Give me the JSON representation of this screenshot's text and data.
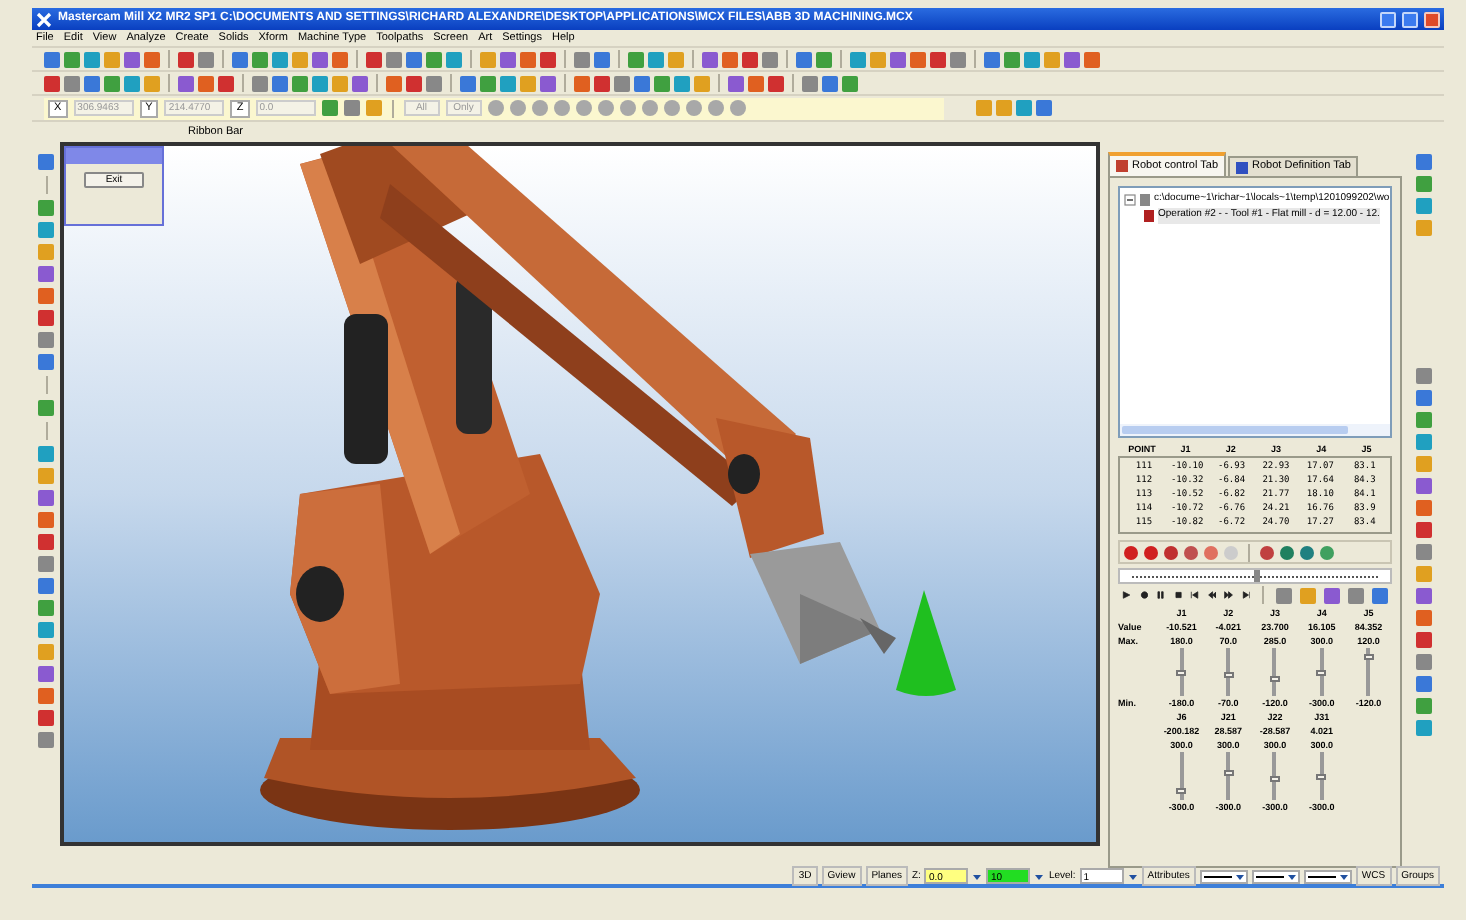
{
  "window": {
    "title": "Mastercam Mill X2 MR2 SP1  C:\\DOCUMENTS AND SETTINGS\\RICHARD ALEXANDRE\\DESKTOP\\APPLICATIONS\\MCX FILES\\ABB 3D MACHINING.MCX"
  },
  "menu": [
    "File",
    "Edit",
    "View",
    "Analyze",
    "Create",
    "Solids",
    "Xform",
    "Machine Type",
    "Toolpaths",
    "Screen",
    "Art",
    "Settings",
    "Help"
  ],
  "coordinates": [
    {
      "label": "X",
      "value": "306.9463",
      "disabled": true
    },
    {
      "label": "Y",
      "value": "214.4770",
      "disabled": true
    },
    {
      "label": "Z",
      "value": "0.0",
      "disabled": true
    }
  ],
  "selection_fields": [
    {
      "text": "All",
      "disabled": true
    },
    {
      "text": "Only",
      "disabled": true
    }
  ],
  "ribbon": {
    "title": "Ribbon Bar"
  },
  "dialog": {
    "button": "Exit"
  },
  "panel": {
    "tabs": [
      {
        "label": "Robot control Tab",
        "selected": true
      },
      {
        "label": "Robot Definition Tab",
        "selected": false
      }
    ],
    "tree": [
      {
        "label": "c:\\docume~1\\richar~1\\locals~1\\temp\\1201099202\\wo",
        "expanded": true,
        "children": [
          {
            "label": "Operation #2 -   - Tool #1 - Flat mill - d = 12.00 - 12."
          }
        ]
      }
    ],
    "point_table": {
      "columns": [
        "POINT",
        "J1",
        "J2",
        "J3",
        "J4",
        "J5"
      ],
      "rows": [
        [
          "111",
          "-10.10",
          "-6.93",
          "22.93",
          "17.07",
          "83.1"
        ],
        [
          "112",
          "-10.32",
          "-6.84",
          "21.30",
          "17.64",
          "84.3"
        ],
        [
          "113",
          "-10.52",
          "-6.82",
          "21.77",
          "18.10",
          "84.1"
        ],
        [
          "114",
          "-10.72",
          "-6.76",
          "24.21",
          "16.76",
          "83.9"
        ],
        [
          "115",
          "-10.82",
          "-6.72",
          "24.70",
          "17.27",
          "83.4"
        ]
      ]
    },
    "timeline": {
      "level": 0.5
    },
    "joint_labels": {
      "value": "Value",
      "max": "Max.",
      "min": "Min."
    },
    "joint_groups": [
      [
        {
          "name": "J1",
          "value": "-10.521",
          "max": "180.0",
          "min": "-180.0",
          "level": 0.47
        },
        {
          "name": "J2",
          "value": "-4.021",
          "max": "70.0",
          "min": "-70.0",
          "level": 0.45
        },
        {
          "name": "J3",
          "value": "23.700",
          "max": "285.0",
          "min": "-120.0",
          "level": 0.35
        },
        {
          "name": "J4",
          "value": "16.105",
          "max": "300.0",
          "min": "-300.0",
          "level": 0.5
        },
        {
          "name": "J5",
          "value": "84.352",
          "max": "120.0",
          "min": "-120.0",
          "level": 0.85
        }
      ],
      [
        {
          "name": "J6",
          "value": "-200.182",
          "max": "300.0",
          "min": "-300.0",
          "level": 0.15
        },
        {
          "name": "J21",
          "value": "28.587",
          "max": "300.0",
          "min": "-300.0",
          "level": 0.55
        },
        {
          "name": "J22",
          "value": "-28.587",
          "max": "300.0",
          "min": "-300.0",
          "level": 0.45
        },
        {
          "name": "J31",
          "value": "4.021",
          "max": "300.0",
          "min": "-300.0",
          "level": 0.5
        }
      ]
    ]
  },
  "status_bar": [
    {
      "kind": "button",
      "text": "3D"
    },
    {
      "kind": "button",
      "text": "Gview"
    },
    {
      "kind": "button",
      "text": "Planes"
    },
    {
      "kind": "label",
      "text": "Z:"
    },
    {
      "kind": "field",
      "value": "0.0",
      "color": "#ffff80"
    },
    {
      "kind": "field",
      "value": "10",
      "color": "#22dd22"
    },
    {
      "kind": "label",
      "text": "Level:"
    },
    {
      "kind": "field",
      "value": "1",
      "color": "#ffffff"
    },
    {
      "kind": "button",
      "text": "Attributes"
    },
    {
      "kind": "line"
    },
    {
      "kind": "line"
    },
    {
      "kind": "line"
    },
    {
      "kind": "button",
      "text": "WCS"
    },
    {
      "kind": "button",
      "text": "Groups"
    }
  ]
}
